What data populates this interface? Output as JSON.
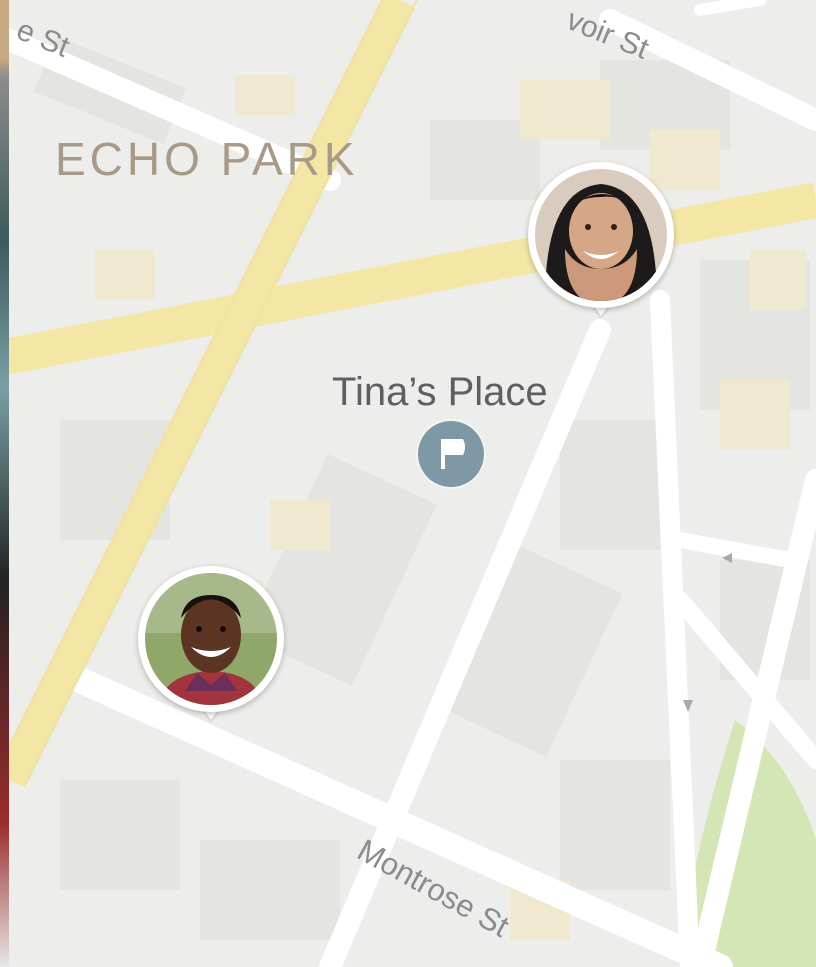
{
  "map": {
    "area_label": "ECHO PARK",
    "place": {
      "name": "Tina’s Place",
      "icon": "flag-icon",
      "pin_color": "#7e98a6"
    },
    "streets": [
      "e St",
      "voir St",
      "Montrose St"
    ],
    "people": [
      {
        "name": "Woman avatar",
        "icon": "avatar-woman-icon"
      },
      {
        "name": "Man avatar",
        "icon": "avatar-man-icon"
      }
    ],
    "colors": {
      "major_road": "#f4e7a5",
      "minor_road": "#ffffff",
      "park": "#d4e6b5",
      "background": "#ededeb"
    }
  }
}
